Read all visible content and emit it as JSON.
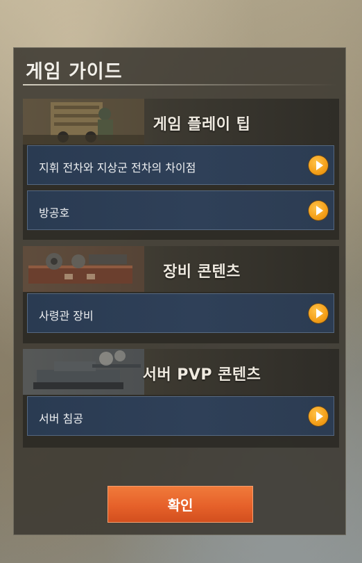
{
  "dialog": {
    "title": "게임 가이드",
    "confirm_label": "확인"
  },
  "sections": [
    {
      "title": "게임 플레이 팁",
      "items": [
        {
          "label": "지휘 전차와 지상군 전차의 차이점",
          "icon": "play-arrow-icon"
        },
        {
          "label": "방공호",
          "icon": "play-arrow-icon"
        }
      ]
    },
    {
      "title": "장비 콘텐츠",
      "items": [
        {
          "label": "사령관 장비",
          "icon": "play-arrow-icon"
        }
      ]
    },
    {
      "title": "서버 PVP 콘텐츠",
      "items": [
        {
          "label": "서버 침공",
          "icon": "play-arrow-icon"
        }
      ]
    }
  ],
  "colors": {
    "accent_orange": "#f5a11b",
    "confirm_button": "#e6612a",
    "item_background": "#2f4058"
  }
}
